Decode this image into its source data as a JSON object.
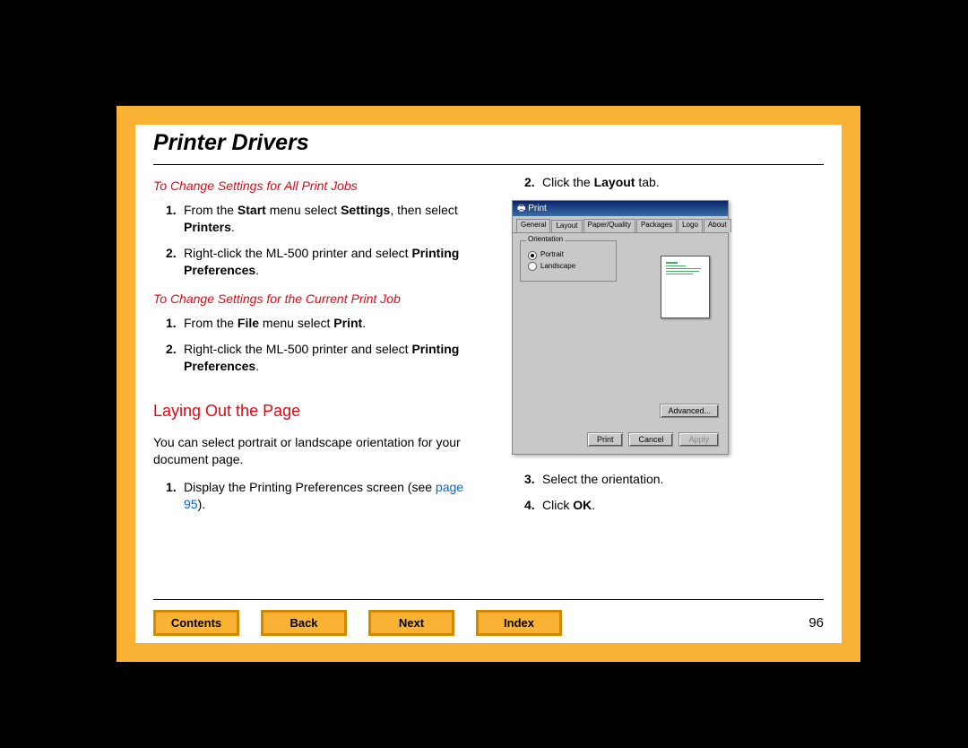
{
  "title": "Printer Drivers",
  "page_number": "96",
  "left": {
    "h1": "To Change Settings for All Print Jobs",
    "s1": [
      {
        "n": "1.",
        "pre": "From the ",
        "b1": "Start",
        "mid": " menu select ",
        "b2": "Settings",
        "mid2": ", then select ",
        "b3": "Printers",
        "post": "."
      },
      {
        "n": "2.",
        "pre": "Right-click the ML-500 printer and select ",
        "b1": "Printing Preferences",
        "post": "."
      }
    ],
    "h2": "To Change Settings for the Current Print Job",
    "s2": [
      {
        "n": "1.",
        "pre": "From the ",
        "b1": "File",
        "mid": " menu select ",
        "b2": "Print",
        "post": "."
      },
      {
        "n": "2.",
        "pre": "Right-click the ML-500 printer and select ",
        "b1": "Printing Preferences",
        "post": "."
      }
    ],
    "h3": "Laying Out the Page",
    "para": "You can select portrait or landscape orientation for your document page.",
    "s3": [
      {
        "n": "1.",
        "pre": "Display the Printing Preferences screen (see ",
        "link": "page 95",
        "post": ")."
      }
    ]
  },
  "right": {
    "s1": [
      {
        "n": "2.",
        "pre": "Click the ",
        "b1": "Layout",
        "post": " tab."
      }
    ],
    "s2": [
      {
        "n": "3.",
        "pre": "Select the orientation."
      },
      {
        "n": "4.",
        "pre": "Click ",
        "b1": "OK",
        "post": "."
      }
    ]
  },
  "dialog": {
    "title": "Print",
    "tabs": [
      "General",
      "Layout",
      "Paper/Quality",
      "Packages",
      "Logo",
      "About"
    ],
    "active_tab": 1,
    "group_label": "Orientation",
    "radios": [
      "Portrait",
      "Landscape"
    ],
    "selected_radio": 0,
    "advanced": "Advanced...",
    "buttons": [
      "Print",
      "Cancel",
      "Apply"
    ]
  },
  "nav": {
    "contents": "Contents",
    "back": "Back",
    "next": "Next",
    "index": "Index"
  }
}
